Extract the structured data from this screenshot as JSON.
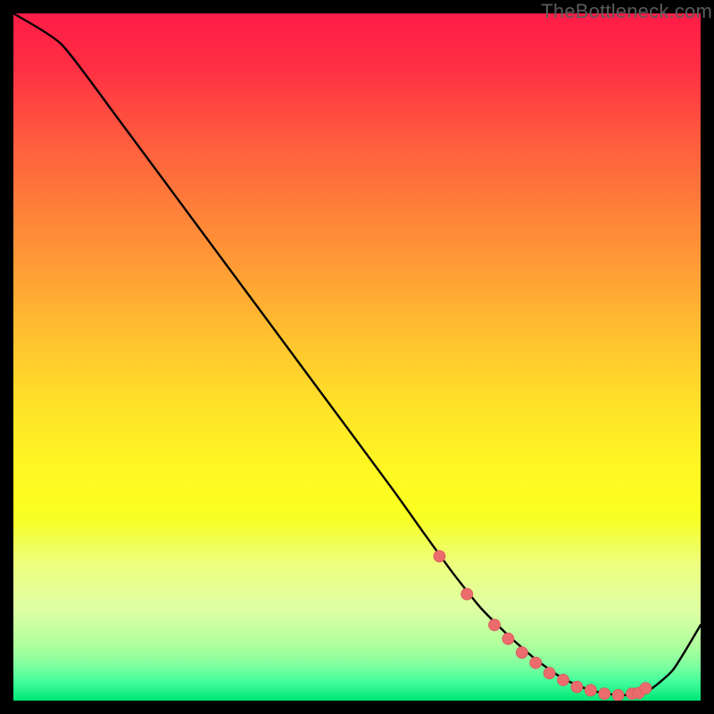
{
  "watermark": "TheBottleneck.com",
  "colors": {
    "curve": "#000000",
    "marker_fill": "#ec6b6d",
    "marker_stroke": "#d95a5c"
  },
  "chart_data": {
    "type": "line",
    "title": "",
    "xlabel": "",
    "ylabel": "",
    "xlim": [
      0,
      100
    ],
    "ylim": [
      0,
      100
    ],
    "grid": false,
    "legend": false,
    "series": [
      {
        "name": "bottleneck-curve",
        "x": [
          0,
          7,
          15,
          25,
          35,
          45,
          55,
          60,
          64,
          68,
          72,
          76,
          80,
          84,
          88,
          92,
          96,
          100
        ],
        "y": [
          100,
          95.5,
          85,
          71.5,
          58,
          44.5,
          31,
          24,
          18.5,
          13.5,
          9.5,
          6,
          3.2,
          1.5,
          0.8,
          1.2,
          4.5,
          11
        ]
      }
    ],
    "markers": {
      "name": "highlight-points",
      "x": [
        62,
        66,
        70,
        72,
        74,
        76,
        78,
        80,
        82,
        84,
        86,
        88,
        90,
        91,
        92
      ],
      "y": [
        21,
        15.5,
        11,
        9,
        7,
        5.5,
        4,
        3,
        2,
        1.5,
        1,
        0.8,
        1,
        1.1,
        1.8
      ]
    }
  }
}
